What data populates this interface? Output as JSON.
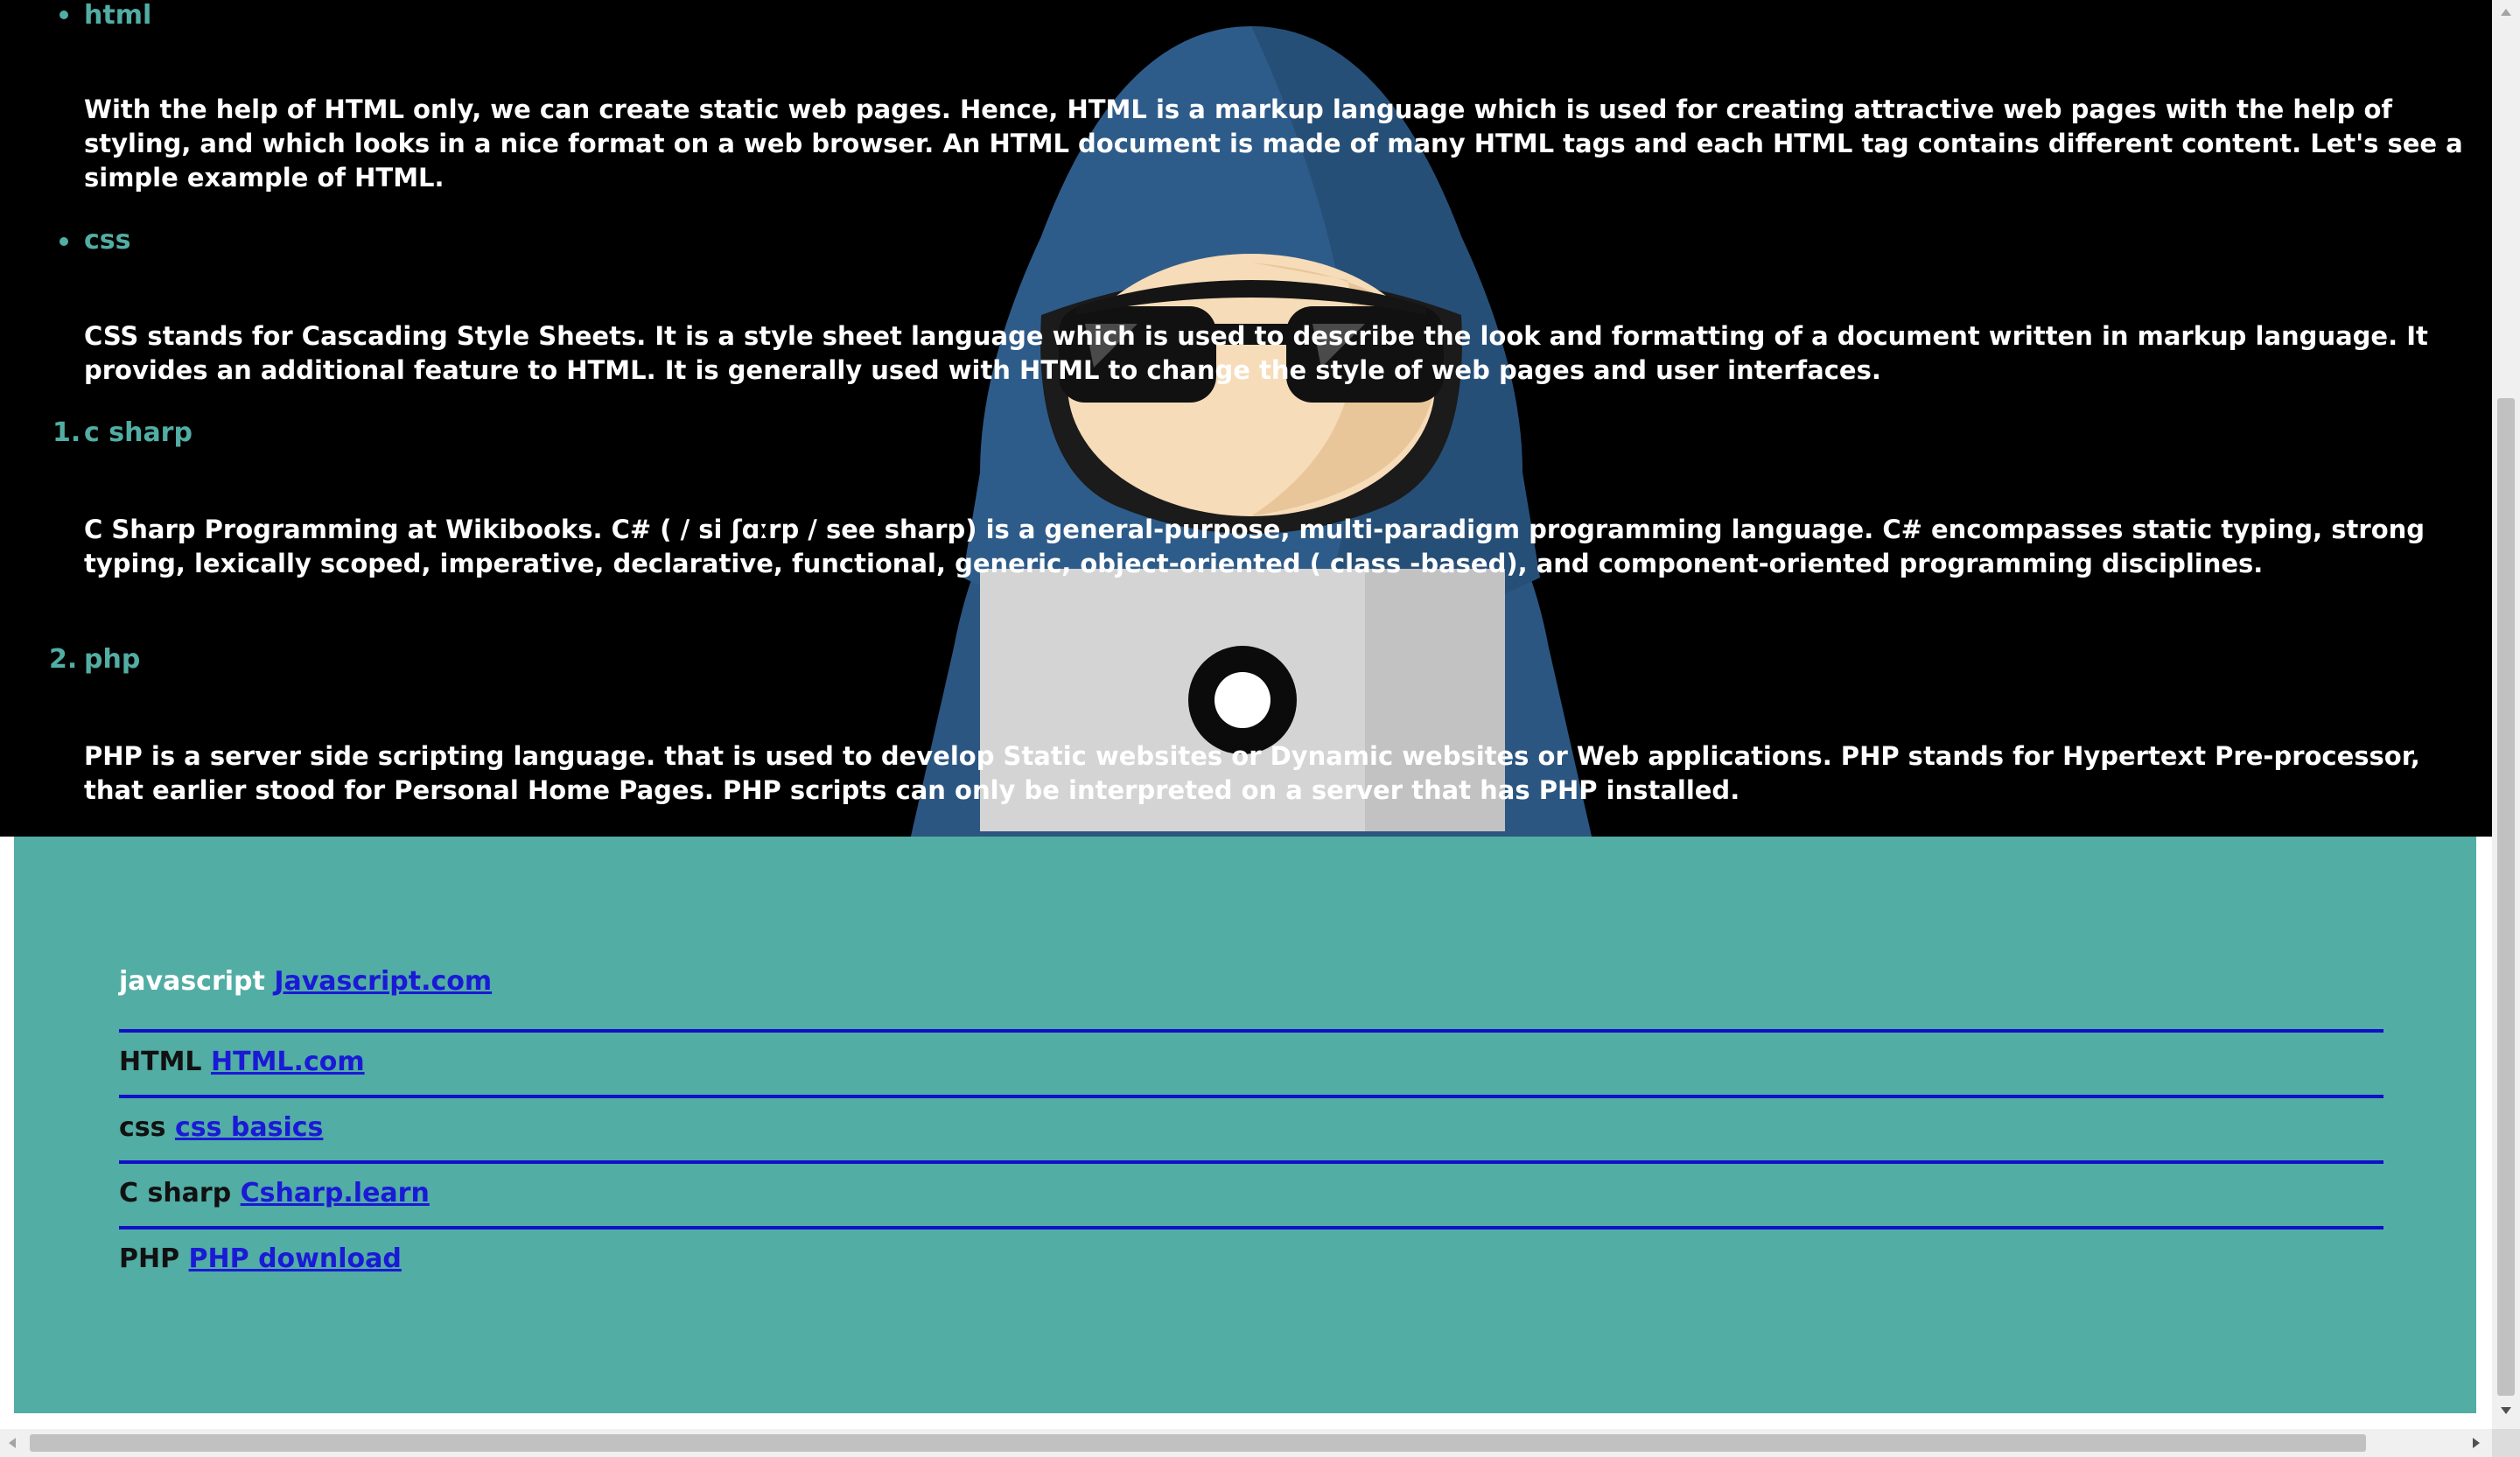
{
  "sections": [
    {
      "marker": "",
      "title": "html",
      "text": "With the help of HTML only, we can create static web pages. Hence, HTML is a markup language which is used for creating attractive web pages with the help of styling, and which looks in a nice format on a web browser. An HTML document is made of many HTML tags and each HTML tag contains different content. Let's see a simple example of HTML."
    },
    {
      "marker": "",
      "title": "css",
      "text": "CSS stands for Cascading Style Sheets. It is a style sheet language which is used to describe the look and formatting of a document written in markup language. It provides an additional feature to HTML. It is generally used with HTML to change the style of web pages and user interfaces."
    },
    {
      "marker": "1.",
      "title": "c sharp",
      "text": "C Sharp Programming at Wikibooks. C# ( / si ʃɑːrp / see sharp) is a general-purpose, multi-paradigm programming language. C# encompasses static typing, strong typing, lexically scoped, imperative, declarative, functional, generic, object-oriented ( class -based), and component-oriented programming disciplines."
    },
    {
      "marker": "2.",
      "title": "php",
      "text": "PHP is a server side scripting language. that is used to develop Static websites or Dynamic websites or Web applications. PHP stands for Hypertext Pre-processor, that earlier stood for Personal Home Pages. PHP scripts can only be interpreted on a server that has PHP installed."
    }
  ],
  "footer": {
    "links": [
      {
        "label": "javascript",
        "link": "Javascript.com"
      },
      {
        "label": "HTML",
        "link": "HTML.com"
      },
      {
        "label": "css",
        "link": "css basics"
      },
      {
        "label": "C sharp",
        "link": "Csharp.learn"
      },
      {
        "label": "PHP",
        "link": "PHP download"
      }
    ]
  },
  "colors": {
    "page_background": "#000000",
    "accent": "#52ada4",
    "body_text": "#ffffff",
    "link": "#1a1ad6",
    "divider": "#1010c8"
  },
  "illustration": {
    "icon": "hacker-hoodie-laptop-icon"
  }
}
